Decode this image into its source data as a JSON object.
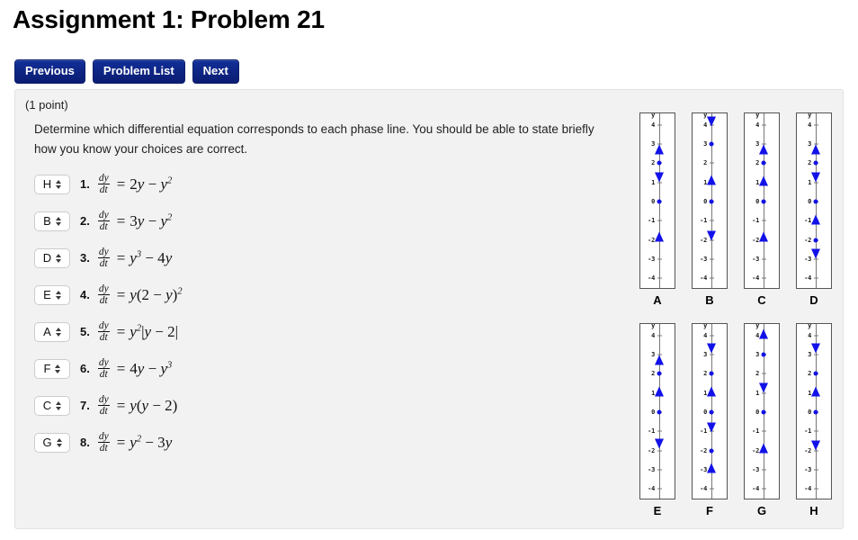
{
  "header": {
    "title": "Assignment 1: Problem 21",
    "nav": [
      {
        "label": "Previous",
        "name": "previous-button"
      },
      {
        "label": "Problem List",
        "name": "problem-list-button"
      },
      {
        "label": "Next",
        "name": "next-button"
      }
    ]
  },
  "problem": {
    "point_value": "(1 point)",
    "instructions": "Determine which differential equation corresponds to each phase line. You should be able to state briefly how you know your choices are correct.",
    "answers": [
      {
        "index": "1.",
        "selected": "H",
        "lhs_num": "dy",
        "lhs_den": "dt",
        "equation_html": "2<i>y</i> &minus; <i>y</i><sup>2</sup>",
        "equation_text": "dy/dt = 2y - y^2"
      },
      {
        "index": "2.",
        "selected": "B",
        "lhs_num": "dy",
        "lhs_den": "dt",
        "equation_html": "3<i>y</i> &minus; <i>y</i><sup>2</sup>",
        "equation_text": "dy/dt = 3y - y^2"
      },
      {
        "index": "3.",
        "selected": "D",
        "lhs_num": "dy",
        "lhs_den": "dt",
        "equation_html": "<i>y</i><sup>3</sup> &minus; 4<i>y</i>",
        "equation_text": "dy/dt = y^3 - 4y"
      },
      {
        "index": "4.",
        "selected": "E",
        "lhs_num": "dy",
        "lhs_den": "dt",
        "equation_html": "<i>y</i>(2 &minus; <i>y</i>)<sup>2</sup>",
        "equation_text": "dy/dt = y(2 - y)^2"
      },
      {
        "index": "5.",
        "selected": "A",
        "lhs_num": "dy",
        "lhs_den": "dt",
        "equation_html": "<i>y</i><sup>2</sup>|<i>y</i> &minus; 2|",
        "equation_text": "dy/dt = y^2|y - 2|"
      },
      {
        "index": "6.",
        "selected": "F",
        "lhs_num": "dy",
        "lhs_den": "dt",
        "equation_html": "4<i>y</i> &minus; <i>y</i><sup>3</sup>",
        "equation_text": "dy/dt = 4y - y^3"
      },
      {
        "index": "7.",
        "selected": "C",
        "lhs_num": "dy",
        "lhs_den": "dt",
        "equation_html": "<i>y</i>(<i>y</i> &minus; 2)",
        "equation_text": "dy/dt = y(y - 2)"
      },
      {
        "index": "8.",
        "selected": "G",
        "lhs_num": "dy",
        "lhs_den": "dt",
        "equation_html": "<i>y</i><sup>2</sup> &minus; 3<i>y</i>",
        "equation_text": "dy/dt = y^2 - 3y"
      }
    ],
    "select_options": [
      "A",
      "B",
      "C",
      "D",
      "E",
      "F",
      "G",
      "H"
    ]
  },
  "phase_lines": {
    "axis_label": "y",
    "tick_labels": [
      "4",
      "3",
      "2",
      "1",
      "0",
      "-1",
      "-2",
      "-3",
      "-4"
    ],
    "tick_values": [
      4,
      3,
      2,
      1,
      0,
      -1,
      -2,
      -3,
      -4
    ],
    "y_min": -4.6,
    "y_max": 4.6,
    "colors": {
      "marker": "#1212e8",
      "axis": "#777777",
      "box_border": "#555555"
    },
    "diagrams": [
      {
        "label": "A",
        "equilibria": [
          2,
          0
        ],
        "arrows": [
          {
            "y": 2.72,
            "dir": "up"
          },
          {
            "y": 1.28,
            "dir": "down"
          },
          {
            "y": -1.82,
            "dir": "up"
          }
        ]
      },
      {
        "label": "B",
        "equilibria": [
          3,
          0
        ],
        "arrows": [
          {
            "y": 4.18,
            "dir": "down"
          },
          {
            "y": 1.12,
            "dir": "up"
          },
          {
            "y": -1.78,
            "dir": "down"
          }
        ]
      },
      {
        "label": "C",
        "equilibria": [
          2,
          0
        ],
        "arrows": [
          {
            "y": 2.72,
            "dir": "up"
          },
          {
            "y": 1.08,
            "dir": "up"
          },
          {
            "y": -1.82,
            "dir": "up"
          }
        ]
      },
      {
        "label": "D",
        "equilibria": [
          2,
          0,
          -2
        ],
        "arrows": [
          {
            "y": 2.72,
            "dir": "up"
          },
          {
            "y": 1.28,
            "dir": "down"
          },
          {
            "y": -0.92,
            "dir": "up"
          },
          {
            "y": -2.72,
            "dir": "down"
          }
        ]
      },
      {
        "label": "E",
        "equilibria": [
          2,
          0
        ],
        "arrows": [
          {
            "y": 2.72,
            "dir": "up"
          },
          {
            "y": 1.08,
            "dir": "up"
          },
          {
            "y": -1.65,
            "dir": "down"
          }
        ]
      },
      {
        "label": "F",
        "equilibria": [
          2,
          0,
          -2
        ],
        "arrows": [
          {
            "y": 3.32,
            "dir": "down"
          },
          {
            "y": 1.08,
            "dir": "up"
          },
          {
            "y": -0.82,
            "dir": "down"
          },
          {
            "y": -2.92,
            "dir": "up"
          }
        ]
      },
      {
        "label": "G",
        "equilibria": [
          3,
          0
        ],
        "arrows": [
          {
            "y": 4.08,
            "dir": "up"
          },
          {
            "y": 1.28,
            "dir": "down"
          },
          {
            "y": -1.88,
            "dir": "up"
          }
        ]
      },
      {
        "label": "H",
        "equilibria": [
          2,
          0
        ],
        "arrows": [
          {
            "y": 3.32,
            "dir": "down"
          },
          {
            "y": 1.08,
            "dir": "up"
          },
          {
            "y": -1.72,
            "dir": "down"
          }
        ]
      }
    ]
  }
}
